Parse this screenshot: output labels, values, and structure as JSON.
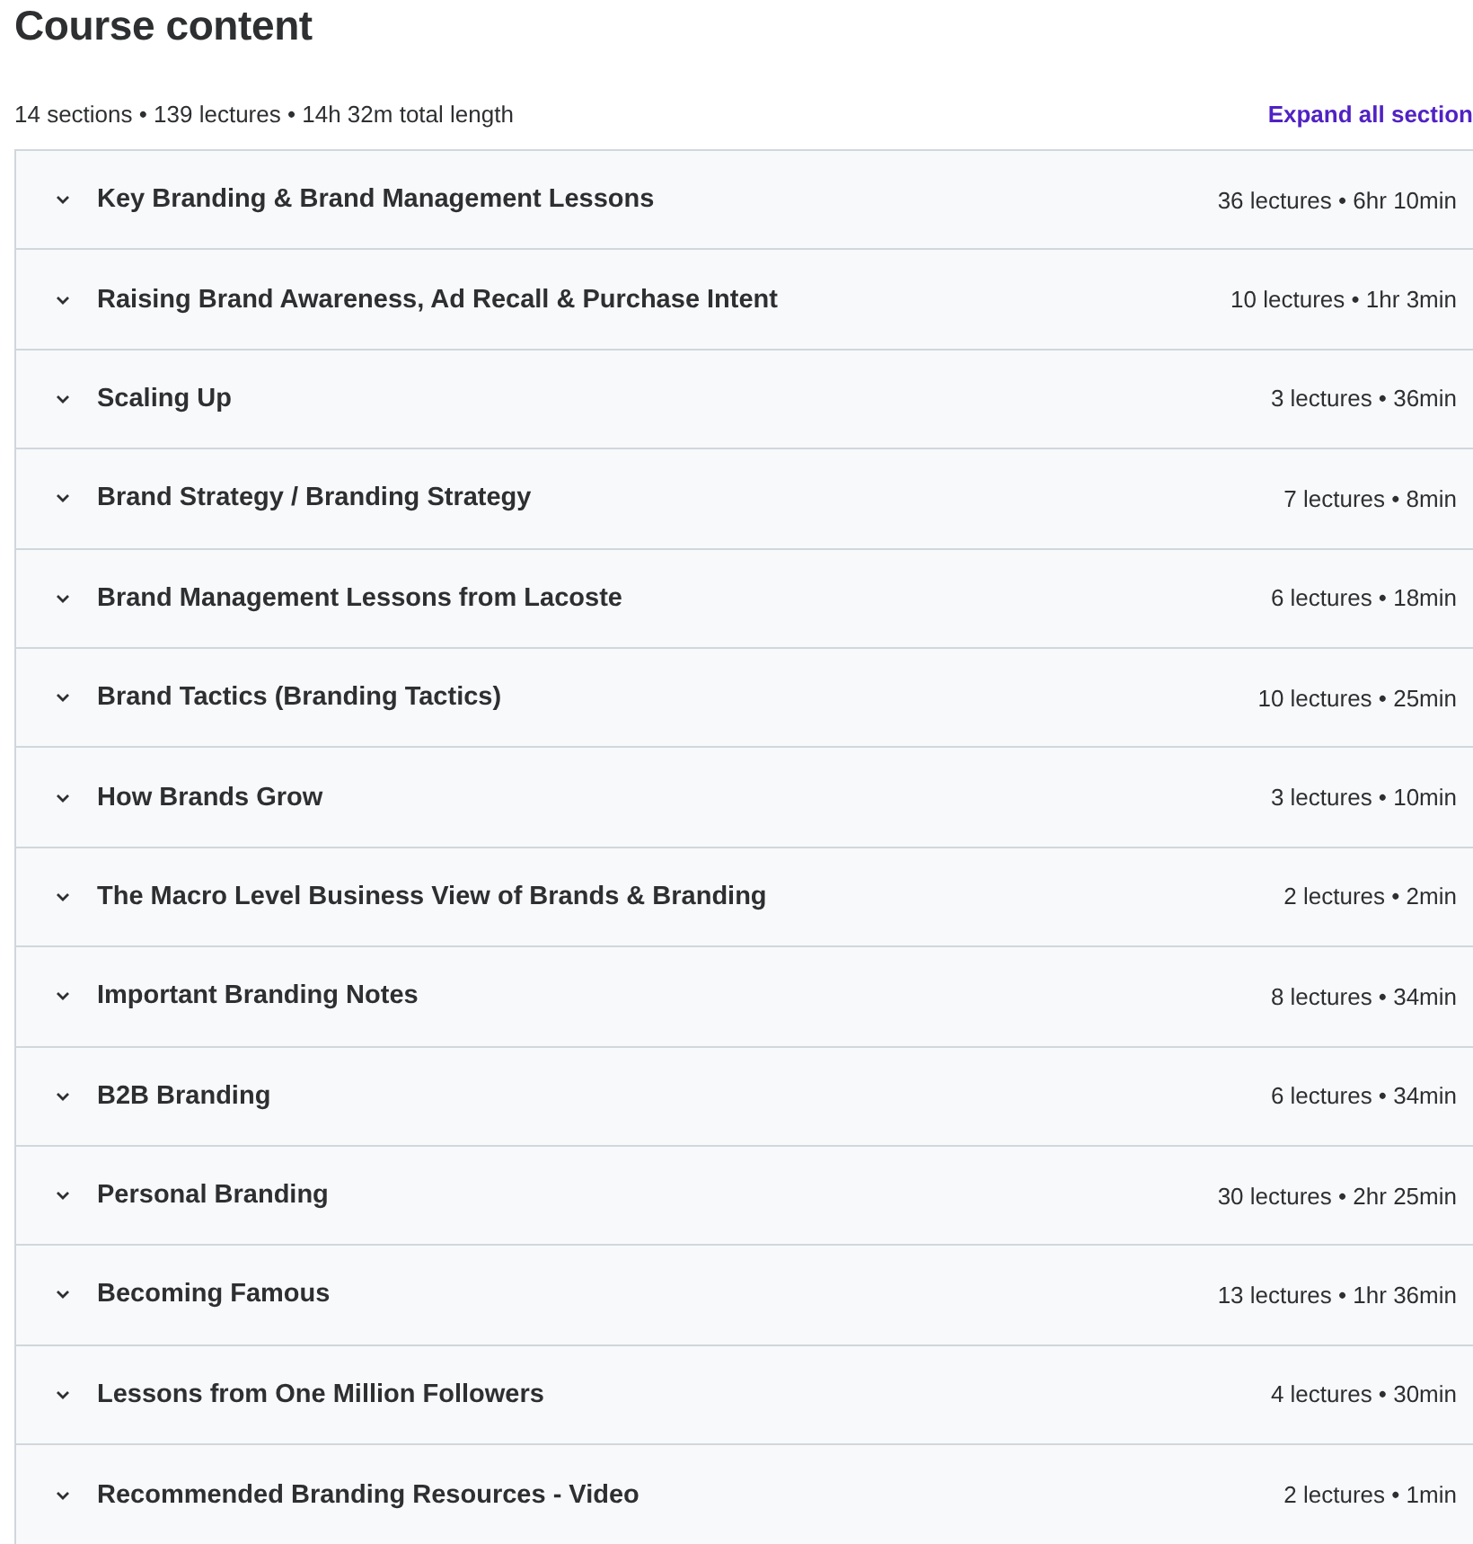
{
  "title": "Course content",
  "summary": "14 sections • 139 lectures • 14h 32m total length",
  "expand_link": "Expand all section",
  "sections": [
    {
      "title": "Key Branding & Brand Management Lessons",
      "meta": "36 lectures • 6hr 10min",
      "expanded": false
    },
    {
      "title": "Raising Brand Awareness, Ad Recall & Purchase Intent",
      "meta": "10 lectures • 1hr 3min",
      "expanded": false
    },
    {
      "title": "Scaling Up",
      "meta": "3 lectures • 36min",
      "expanded": false
    },
    {
      "title": "Brand Strategy / Branding Strategy",
      "meta": "7 lectures • 8min",
      "expanded": false
    },
    {
      "title": "Brand Management Lessons from Lacoste",
      "meta": "6 lectures • 18min",
      "expanded": false
    },
    {
      "title": "Brand Tactics (Branding Tactics)",
      "meta": "10 lectures • 25min",
      "expanded": false
    },
    {
      "title": "How Brands Grow",
      "meta": "3 lectures • 10min",
      "expanded": false
    },
    {
      "title": "The Macro Level Business View of Brands & Branding",
      "meta": "2 lectures • 2min",
      "expanded": false
    },
    {
      "title": "Important Branding Notes",
      "meta": "8 lectures • 34min",
      "expanded": false
    },
    {
      "title": "B2B Branding",
      "meta": "6 lectures • 34min",
      "expanded": false
    },
    {
      "title": "Personal Branding",
      "meta": "30 lectures • 2hr 25min",
      "expanded": false
    },
    {
      "title": "Becoming Famous",
      "meta": "13 lectures • 1hr 36min",
      "expanded": false
    },
    {
      "title": "Lessons from One Million Followers",
      "meta": "4 lectures • 30min",
      "expanded": false
    },
    {
      "title": "Recommended Branding Resources - Video",
      "meta": "2 lectures • 1min",
      "expanded": false
    }
  ]
}
